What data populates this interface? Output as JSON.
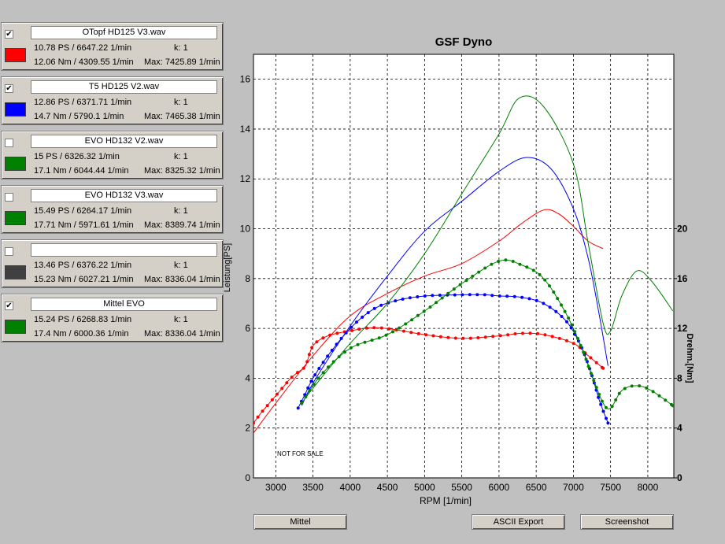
{
  "panels": [
    {
      "checked": true,
      "name": "OTopf HD125 V3.wav",
      "color": "#ff0000",
      "power": "10.78 PS / 6647.22 1/min",
      "k": "k: 1",
      "torque": "12.06 Nm / 4309.55 1/min",
      "max": "Max: 7425.89 1/min"
    },
    {
      "checked": true,
      "name": "T5 HD125 V2.wav",
      "color": "#0000ff",
      "power": "12.86 PS / 6371.71 1/min",
      "k": "k: 1",
      "torque": "14.7 Nm / 5790.1 1/min",
      "max": "Max: 7465.38 1/min"
    },
    {
      "checked": false,
      "name": "EVO HD132 V2.wav",
      "color": "#008000",
      "power": "15 PS / 6326.32 1/min",
      "k": "k: 1",
      "torque": "17.1 Nm / 6044.44 1/min",
      "max": "Max: 8325.32 1/min"
    },
    {
      "checked": false,
      "name": "EVO HD132 V3.wav",
      "color": "#008000",
      "power": "15.49 PS / 6264.17 1/min",
      "k": "k: 1",
      "torque": "17.71 Nm / 5971.61 1/min",
      "max": "Max: 8389.74 1/min"
    },
    {
      "checked": false,
      "name": "",
      "color": "#404040",
      "power": "13.46 PS / 6376.22 1/min",
      "k": "k: 1",
      "torque": "15.23 Nm / 6027.21 1/min",
      "max": "Max: 8336.04 1/min"
    },
    {
      "checked": true,
      "name": "Mittel EVO",
      "color": "#008000",
      "power": "15.24 PS / 6268.83 1/min",
      "k": "k: 1",
      "torque": "17.4 Nm / 6000.36 1/min",
      "max": "Max: 8336.04 1/min"
    }
  ],
  "buttons": {
    "mittel": "Mittel",
    "ascii": "ASCII Export",
    "screenshot": "Screenshot"
  },
  "chart_data": {
    "type": "line",
    "title": "GSF Dyno",
    "xlabel": "RPM [1/min]",
    "ylabel_left": "Leistung[PS]",
    "ylabel_right": "Drehm.[Nm]",
    "watermark": "NOT FOR SALE",
    "xlim": [
      2700,
      8350
    ],
    "ylim_left": [
      0,
      17
    ],
    "ylim_right": [
      0,
      34
    ],
    "x_ticks": [
      3000,
      3500,
      4000,
      4500,
      5000,
      5500,
      6000,
      6500,
      7000,
      7500,
      8000
    ],
    "y_ticks_left": [
      0,
      2,
      4,
      6,
      8,
      10,
      12,
      14,
      16
    ],
    "y_ticks_right": [
      0,
      4,
      8,
      12,
      16,
      20
    ],
    "grid": true,
    "series": [
      {
        "quantity": "power",
        "axis": "left",
        "color": "#ff0000",
        "markers": false,
        "points": [
          [
            2700,
            1.8
          ],
          [
            3000,
            3.0
          ],
          [
            3500,
            4.9
          ],
          [
            4000,
            6.5
          ],
          [
            4500,
            7.4
          ],
          [
            5000,
            8.1
          ],
          [
            5500,
            8.6
          ],
          [
            6000,
            9.5
          ],
          [
            6300,
            10.2
          ],
          [
            6600,
            10.75
          ],
          [
            6800,
            10.6
          ],
          [
            7000,
            10.1
          ],
          [
            7200,
            9.5
          ],
          [
            7400,
            9.2
          ]
        ]
      },
      {
        "quantity": "torque",
        "axis": "right",
        "color": "#ff0000",
        "markers": true,
        "points": [
          [
            2700,
            4.4
          ],
          [
            2800,
            5.2
          ],
          [
            2900,
            5.9
          ],
          [
            3000,
            6.6
          ],
          [
            3100,
            7.3
          ],
          [
            3200,
            8.0
          ],
          [
            3300,
            8.5
          ],
          [
            3400,
            9.0
          ],
          [
            3500,
            10.6
          ],
          [
            3700,
            11.4
          ],
          [
            4000,
            11.8
          ],
          [
            4300,
            12.06
          ],
          [
            4600,
            11.9
          ],
          [
            5000,
            11.5
          ],
          [
            5500,
            11.2
          ],
          [
            6000,
            11.4
          ],
          [
            6300,
            11.6
          ],
          [
            6600,
            11.5
          ],
          [
            7000,
            10.8
          ],
          [
            7200,
            9.8
          ],
          [
            7400,
            8.8
          ]
        ]
      },
      {
        "quantity": "power",
        "axis": "left",
        "color": "#0000ff",
        "markers": false,
        "points": [
          [
            3350,
            2.9
          ],
          [
            3500,
            3.8
          ],
          [
            4000,
            6.1
          ],
          [
            4500,
            8.1
          ],
          [
            5000,
            9.9
          ],
          [
            5500,
            11.1
          ],
          [
            6000,
            12.3
          ],
          [
            6370,
            12.86
          ],
          [
            6700,
            12.4
          ],
          [
            7000,
            10.8
          ],
          [
            7200,
            8.8
          ],
          [
            7350,
            6.5
          ],
          [
            7465,
            4.5
          ]
        ]
      },
      {
        "quantity": "torque",
        "axis": "right",
        "color": "#0000ff",
        "markers": true,
        "points": [
          [
            3300,
            5.6
          ],
          [
            3400,
            6.8
          ],
          [
            3500,
            8.0
          ],
          [
            3700,
            9.8
          ],
          [
            4000,
            12.0
          ],
          [
            4300,
            13.5
          ],
          [
            4600,
            14.2
          ],
          [
            5000,
            14.6
          ],
          [
            5500,
            14.7
          ],
          [
            5800,
            14.7
          ],
          [
            6000,
            14.6
          ],
          [
            6300,
            14.5
          ],
          [
            6600,
            14.0
          ],
          [
            6900,
            12.6
          ],
          [
            7100,
            10.6
          ],
          [
            7250,
            8.2
          ],
          [
            7350,
            6.2
          ],
          [
            7465,
            4.4
          ]
        ]
      },
      {
        "quantity": "power",
        "axis": "left",
        "color": "#008000",
        "markers": false,
        "points": [
          [
            3350,
            3.0
          ],
          [
            3500,
            3.6
          ],
          [
            4000,
            5.4
          ],
          [
            4500,
            7.0
          ],
          [
            5000,
            9.0
          ],
          [
            5500,
            11.4
          ],
          [
            6000,
            13.8
          ],
          [
            6270,
            15.24
          ],
          [
            6600,
            14.9
          ],
          [
            7000,
            12.6
          ],
          [
            7200,
            9.4
          ],
          [
            7400,
            6.2
          ],
          [
            7500,
            5.9
          ],
          [
            7650,
            7.3
          ],
          [
            7850,
            8.3
          ],
          [
            8050,
            7.9
          ],
          [
            8336,
            6.7
          ]
        ]
      },
      {
        "quantity": "torque",
        "axis": "right",
        "color": "#008000",
        "markers": true,
        "points": [
          [
            3350,
            6.0
          ],
          [
            3600,
            8.2
          ],
          [
            4000,
            10.4
          ],
          [
            4500,
            11.5
          ],
          [
            5000,
            13.4
          ],
          [
            5500,
            15.6
          ],
          [
            6000,
            17.4
          ],
          [
            6300,
            17.1
          ],
          [
            6600,
            16.0
          ],
          [
            6900,
            13.2
          ],
          [
            7100,
            10.6
          ],
          [
            7250,
            8.2
          ],
          [
            7400,
            6.0
          ],
          [
            7500,
            5.6
          ],
          [
            7650,
            7.0
          ],
          [
            7850,
            7.4
          ],
          [
            8050,
            7.0
          ],
          [
            8336,
            5.8
          ]
        ]
      }
    ]
  }
}
